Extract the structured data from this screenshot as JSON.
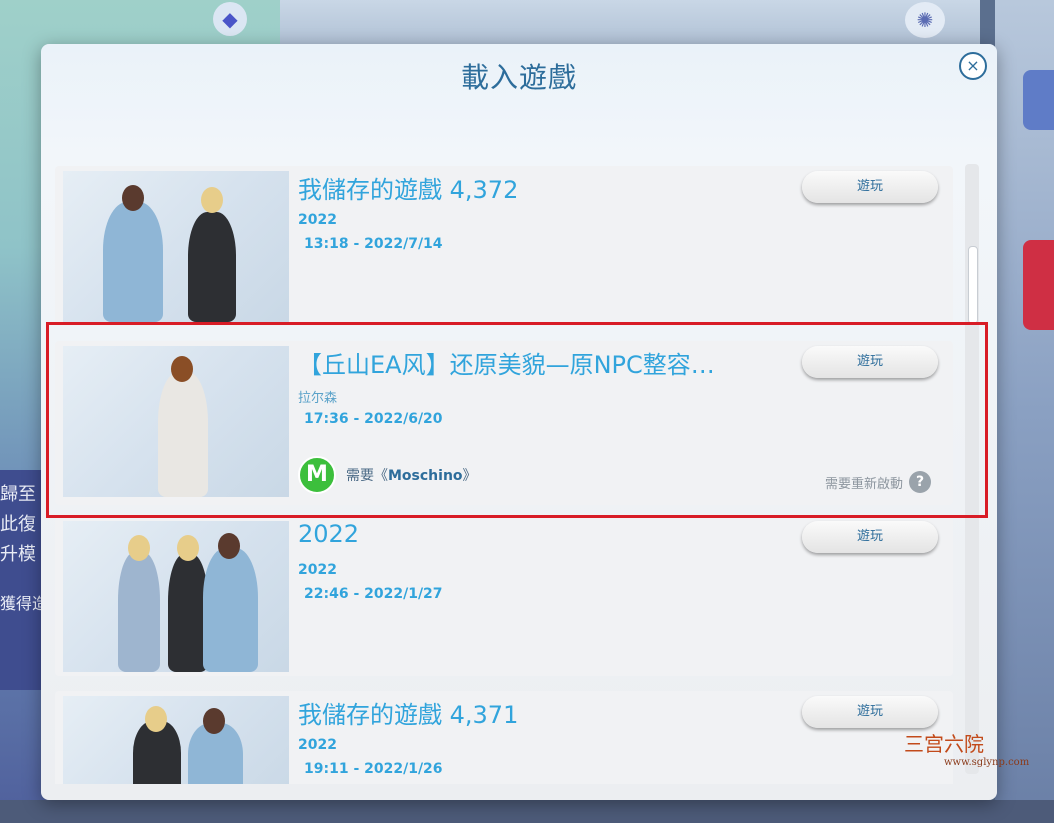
{
  "dialog": {
    "title": "載入遊戲",
    "close_label": "×"
  },
  "saves": [
    {
      "title": "我儲存的遊戲 4,372",
      "subtitle": "2022",
      "timestamp": "13:18 - 2022/7/14",
      "play_label": "遊玩"
    },
    {
      "title": "【丘山EA风】还原美貌—原NPC整容…",
      "subtitle": "拉尔森",
      "timestamp": "17:36 - 2022/6/20",
      "play_label": "遊玩",
      "requirement_prefix": "需要《",
      "requirement_pack": "Moschino",
      "requirement_suffix": "》",
      "requirement_icon": "M",
      "restart_note": "需要重新啟動",
      "help_glyph": "?"
    },
    {
      "title": "2022",
      "subtitle": "2022",
      "timestamp": "22:46 - 2022/1/27",
      "play_label": "遊玩"
    },
    {
      "title": "我儲存的遊戲 4,371",
      "subtitle": "2022",
      "timestamp": "19:11 - 2022/1/26",
      "play_label": "遊玩"
    }
  ],
  "background": {
    "left_panel_lines": [
      "歸至",
      "此復",
      "升模",
      "獲得造"
    ]
  },
  "watermark": {
    "text": "三宫六院",
    "url": "www.sglynp.com"
  },
  "colors": {
    "accent": "#31a4dc",
    "title": "#2d6d9b",
    "highlight": "#d81c26"
  }
}
